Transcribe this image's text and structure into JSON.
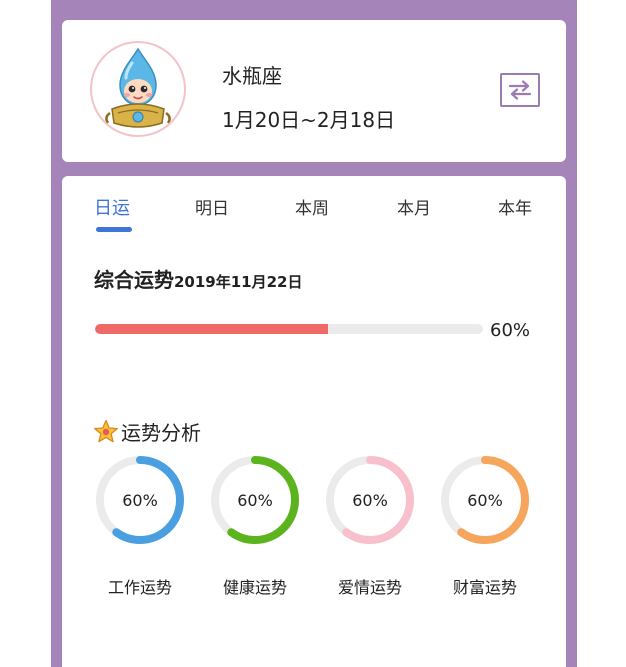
{
  "header": {
    "sign_name": "水瓶座",
    "date_range": "1月20日~2月18日",
    "switch_icon": "swap-arrows-icon"
  },
  "tabs": [
    {
      "label": "日运",
      "active": true
    },
    {
      "label": "明日",
      "active": false
    },
    {
      "label": "本周",
      "active": false
    },
    {
      "label": "本月",
      "active": false
    },
    {
      "label": "本年",
      "active": false
    }
  ],
  "overall": {
    "title": "综合运势",
    "date": "2019年11月22日",
    "value": 60,
    "label": "60%",
    "color": "#ef6a66"
  },
  "analysis": {
    "title": "运势分析",
    "icon": "star-icon",
    "items": [
      {
        "label": "工作运势",
        "value": 60,
        "text": "60%",
        "color": "#4a9fe0"
      },
      {
        "label": "健康运势",
        "value": 60,
        "text": "60%",
        "color": "#5bb31d"
      },
      {
        "label": "爱情运势",
        "value": 60,
        "text": "60%",
        "color": "#f8c0cc"
      },
      {
        "label": "财富运势",
        "value": 60,
        "text": "60%",
        "color": "#f6a55c"
      }
    ]
  },
  "colors": {
    "frame": "#a584ba",
    "accent": "#3f74d8",
    "track": "#ebebeb"
  }
}
